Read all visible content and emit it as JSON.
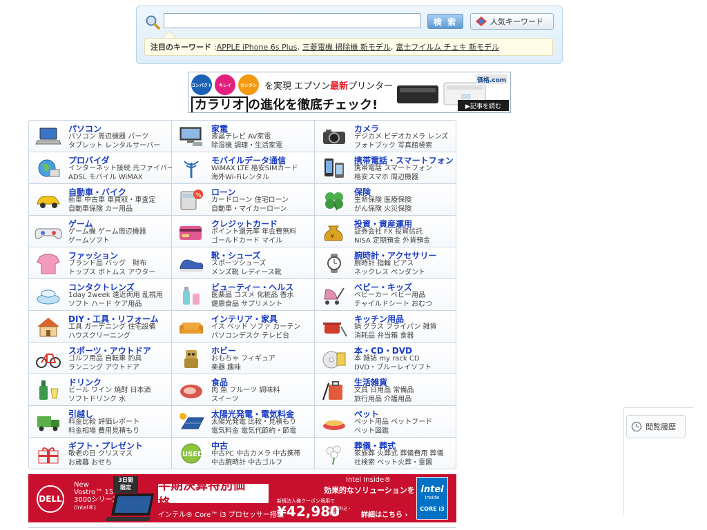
{
  "search": {
    "placeholder": "",
    "button_label": "検 索",
    "popular_label": "人気キーワード",
    "attention_label": "注目のキーワード",
    "attention_prefix": ":",
    "keywords": [
      "APPLE iPhone 6s Plus",
      "三菱電機 掃除機 新モデル",
      "富士フイルム チェキ 新モデル"
    ]
  },
  "banner1": {
    "circles": [
      "コンパクト",
      "キレイ",
      "カンタン"
    ],
    "top_pre": "を実現  エプソン",
    "top_hl": "最新",
    "top_post": "プリンター",
    "main_box": "カラリオ",
    "main_rest": "の進化を徹底チェック!",
    "logo": "価格.com",
    "read": "▶記事を読む"
  },
  "categories": [
    {
      "title": "パソコン",
      "sub1": "パソコン 周辺機器 パーツ",
      "sub2": "タブレット レンタルサーバー",
      "icon": "laptop-icon"
    },
    {
      "title": "家電",
      "sub1": "液晶テレビ AV家電",
      "sub2": "除湿機 調理・生活家電",
      "icon": "tv-icon"
    },
    {
      "title": "カメラ",
      "sub1": "デジカメ ビデオカメラ レンズ",
      "sub2": "フォトブック 写真館検索",
      "icon": "camera-icon"
    },
    {
      "title": "プロバイダ",
      "sub1": "インターネット接続 光ファイバー",
      "sub2": "ADSL モバイル WiMAX",
      "icon": "globe-icon"
    },
    {
      "title": "モバイルデータ通信",
      "sub1": "WiMAX LTE 格安SIMカード",
      "sub2": "海外Wi-Fiレンタル",
      "icon": "antenna-icon"
    },
    {
      "title": "携帯電話・スマートフォン",
      "sub1": "携帯電話 スマートフォン",
      "sub2": "格安スマホ 周辺機器",
      "icon": "smartphone-icon"
    },
    {
      "title": "自動車・バイク",
      "sub1": "新車 中古車 車買取・車査定",
      "sub2": "自動車保険 カー用品",
      "icon": "car-icon"
    },
    {
      "title": "ローン",
      "sub1": "カードローン 住宅ローン",
      "sub2": "自動車・マイカーローン",
      "icon": "calculator-icon"
    },
    {
      "title": "保険",
      "sub1": "生命保険 医療保険",
      "sub2": "がん保険 火災保険",
      "icon": "clover-icon"
    },
    {
      "title": "ゲーム",
      "sub1": "ゲーム機 ゲーム周辺機器",
      "sub2": "ゲームソフト",
      "icon": "gamepad-icon"
    },
    {
      "title": "クレジットカード",
      "sub1": "ポイント還元率 年会費無料",
      "sub2": "ゴールドカード マイル",
      "icon": "credit-card-icon"
    },
    {
      "title": "投資・資産運用",
      "sub1": "証券会社 FX 投資信託",
      "sub2": "NISA 定期預金 外貨預金",
      "icon": "money-bag-icon"
    },
    {
      "title": "ファッション",
      "sub1": "ブランド品 バッグ　財布",
      "sub2": "トップス ボトムス アウター",
      "icon": "shirt-icon"
    },
    {
      "title": "靴・シューズ",
      "sub1": "スポーツシューズ",
      "sub2": "メンズ靴 レディース靴",
      "icon": "shoe-icon"
    },
    {
      "title": "腕時計・アクセサリー",
      "sub1": "腕時計 指輪 ピアス",
      "sub2": "ネックレス ペンダント",
      "icon": "watch-icon"
    },
    {
      "title": "コンタクトレンズ",
      "sub1": "1day 2week 遠近両用 乱視用",
      "sub2": "ソフト ハード ケア用品",
      "icon": "contact-lens-icon"
    },
    {
      "title": "ビューティー・ヘルス",
      "sub1": "医薬品 コスメ 化粧品 香水",
      "sub2": "健康食品 サプリメント",
      "icon": "cosmetics-icon"
    },
    {
      "title": "ベビー・キッズ",
      "sub1": "ベビーカー ベビー用品",
      "sub2": "チャイルドシート おむつ",
      "icon": "stroller-icon"
    },
    {
      "title": "DIY・工具・リフォーム",
      "sub1": "工具 ガーデニング 住宅設備",
      "sub2": "ハウスクリーニング",
      "icon": "house-icon"
    },
    {
      "title": "インテリア・家具",
      "sub1": "イス ベッド ソファ カーテン",
      "sub2": "パソコンデスク テレビ台",
      "icon": "sofa-icon"
    },
    {
      "title": "キッチン用品",
      "sub1": "鍋 グラス フライパン 雑貨",
      "sub2": "消耗品 弁当箱 食器",
      "icon": "pot-icon"
    },
    {
      "title": "スポーツ・アウトドア",
      "sub1": "ゴルフ用品 自転車 釣具",
      "sub2": "ランニング アウトドア",
      "icon": "bicycle-icon"
    },
    {
      "title": "ホビー",
      "sub1": "おもちゃ フィギュア",
      "sub2": "楽器 趣味",
      "icon": "robot-icon"
    },
    {
      "title": "本・CD・DVD",
      "sub1": "本 雑誌 my rack CD",
      "sub2": "DVD・ブルーレイソフト",
      "icon": "cd-icon"
    },
    {
      "title": "ドリンク",
      "sub1": "ビール ワイン 焼酎 日本酒",
      "sub2": "ソフトドリンク 水",
      "icon": "bottle-icon"
    },
    {
      "title": "食品",
      "sub1": "肉 魚 フルーツ 調味料",
      "sub2": "スイーツ",
      "icon": "meat-icon"
    },
    {
      "title": "生活雑貨",
      "sub1": "文具 日用品 常備品",
      "sub2": "旅行用品 介護用品",
      "icon": "suitcase-icon"
    },
    {
      "title": "引越し",
      "sub1": "料金比較 評価レポート",
      "sub2": "料金相場 費用見積もり",
      "icon": "truck-icon"
    },
    {
      "title": "太陽光発電・電気料金",
      "sub1": "太陽光発電 比較・見積もり",
      "sub2": "電気料金 電気代節約・節電",
      "icon": "solar-panel-icon"
    },
    {
      "title": "ペット",
      "sub1": "ペット用品 ペットフード",
      "sub2": "ペット図鑑",
      "icon": "pet-bowl-icon"
    },
    {
      "title": "ギフト・プレゼント",
      "sub1": "敬老の日 クリスマス",
      "sub2": "お歳暮 おせち",
      "icon": "gift-icon"
    },
    {
      "title": "中古",
      "sub1": "中古PC 中古カメラ 中古携帯",
      "sub2": "中古腕時計 中古ゴルフ",
      "icon": "used-badge-icon"
    },
    {
      "title": "葬儀・葬式",
      "sub1": "家族葬 火葬式 葬儀費用 葬儀",
      "sub2": "社検索 ペット火葬・霊園",
      "icon": "flower-icon"
    }
  ],
  "dell": {
    "logo": "DELL",
    "product_l1": "New",
    "product_l2": "Vostro™ 15",
    "product_l3": "3000シリーズ",
    "product_l4": "(Intel®)",
    "badge_l1": "3日間",
    "badge_l2": "限定",
    "headline": "半期決算特別価格。",
    "cpu": "インテル® Core™ i3 プロセッサー搭載",
    "intel_inside": "Intel Inside®",
    "tagline": "効果的なソリューションを",
    "coupon": "新規法人様クーポン適用で",
    "price": "¥42,980",
    "price_note_l1": "(配送料込・",
    "price_note_l2": "税抜)",
    "details": "詳細はこちら ›",
    "intel_logo_l1": "intel",
    "intel_logo_l2": "inside",
    "intel_logo_l3": "CORE i3"
  },
  "history": {
    "label": "閲覧履歴"
  }
}
